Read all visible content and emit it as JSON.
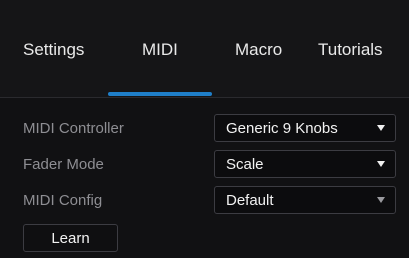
{
  "tabs": [
    {
      "label": "Settings"
    },
    {
      "label": "MIDI",
      "active": true
    },
    {
      "label": "Macro"
    },
    {
      "label": "Tutorials"
    }
  ],
  "midi": {
    "controller": {
      "label": "MIDI Controller",
      "value": "Generic 9 Knobs"
    },
    "fader_mode": {
      "label": "Fader Mode",
      "value": "Scale"
    },
    "config": {
      "label": "MIDI Config",
      "value": "Default"
    },
    "learn_label": "Learn"
  },
  "colors": {
    "accent": "#1f7fc9",
    "background": "#111113",
    "label": "#8e8e93",
    "text": "#f2f2f2"
  },
  "icons": {
    "dropdown": "chevron-down-icon"
  }
}
